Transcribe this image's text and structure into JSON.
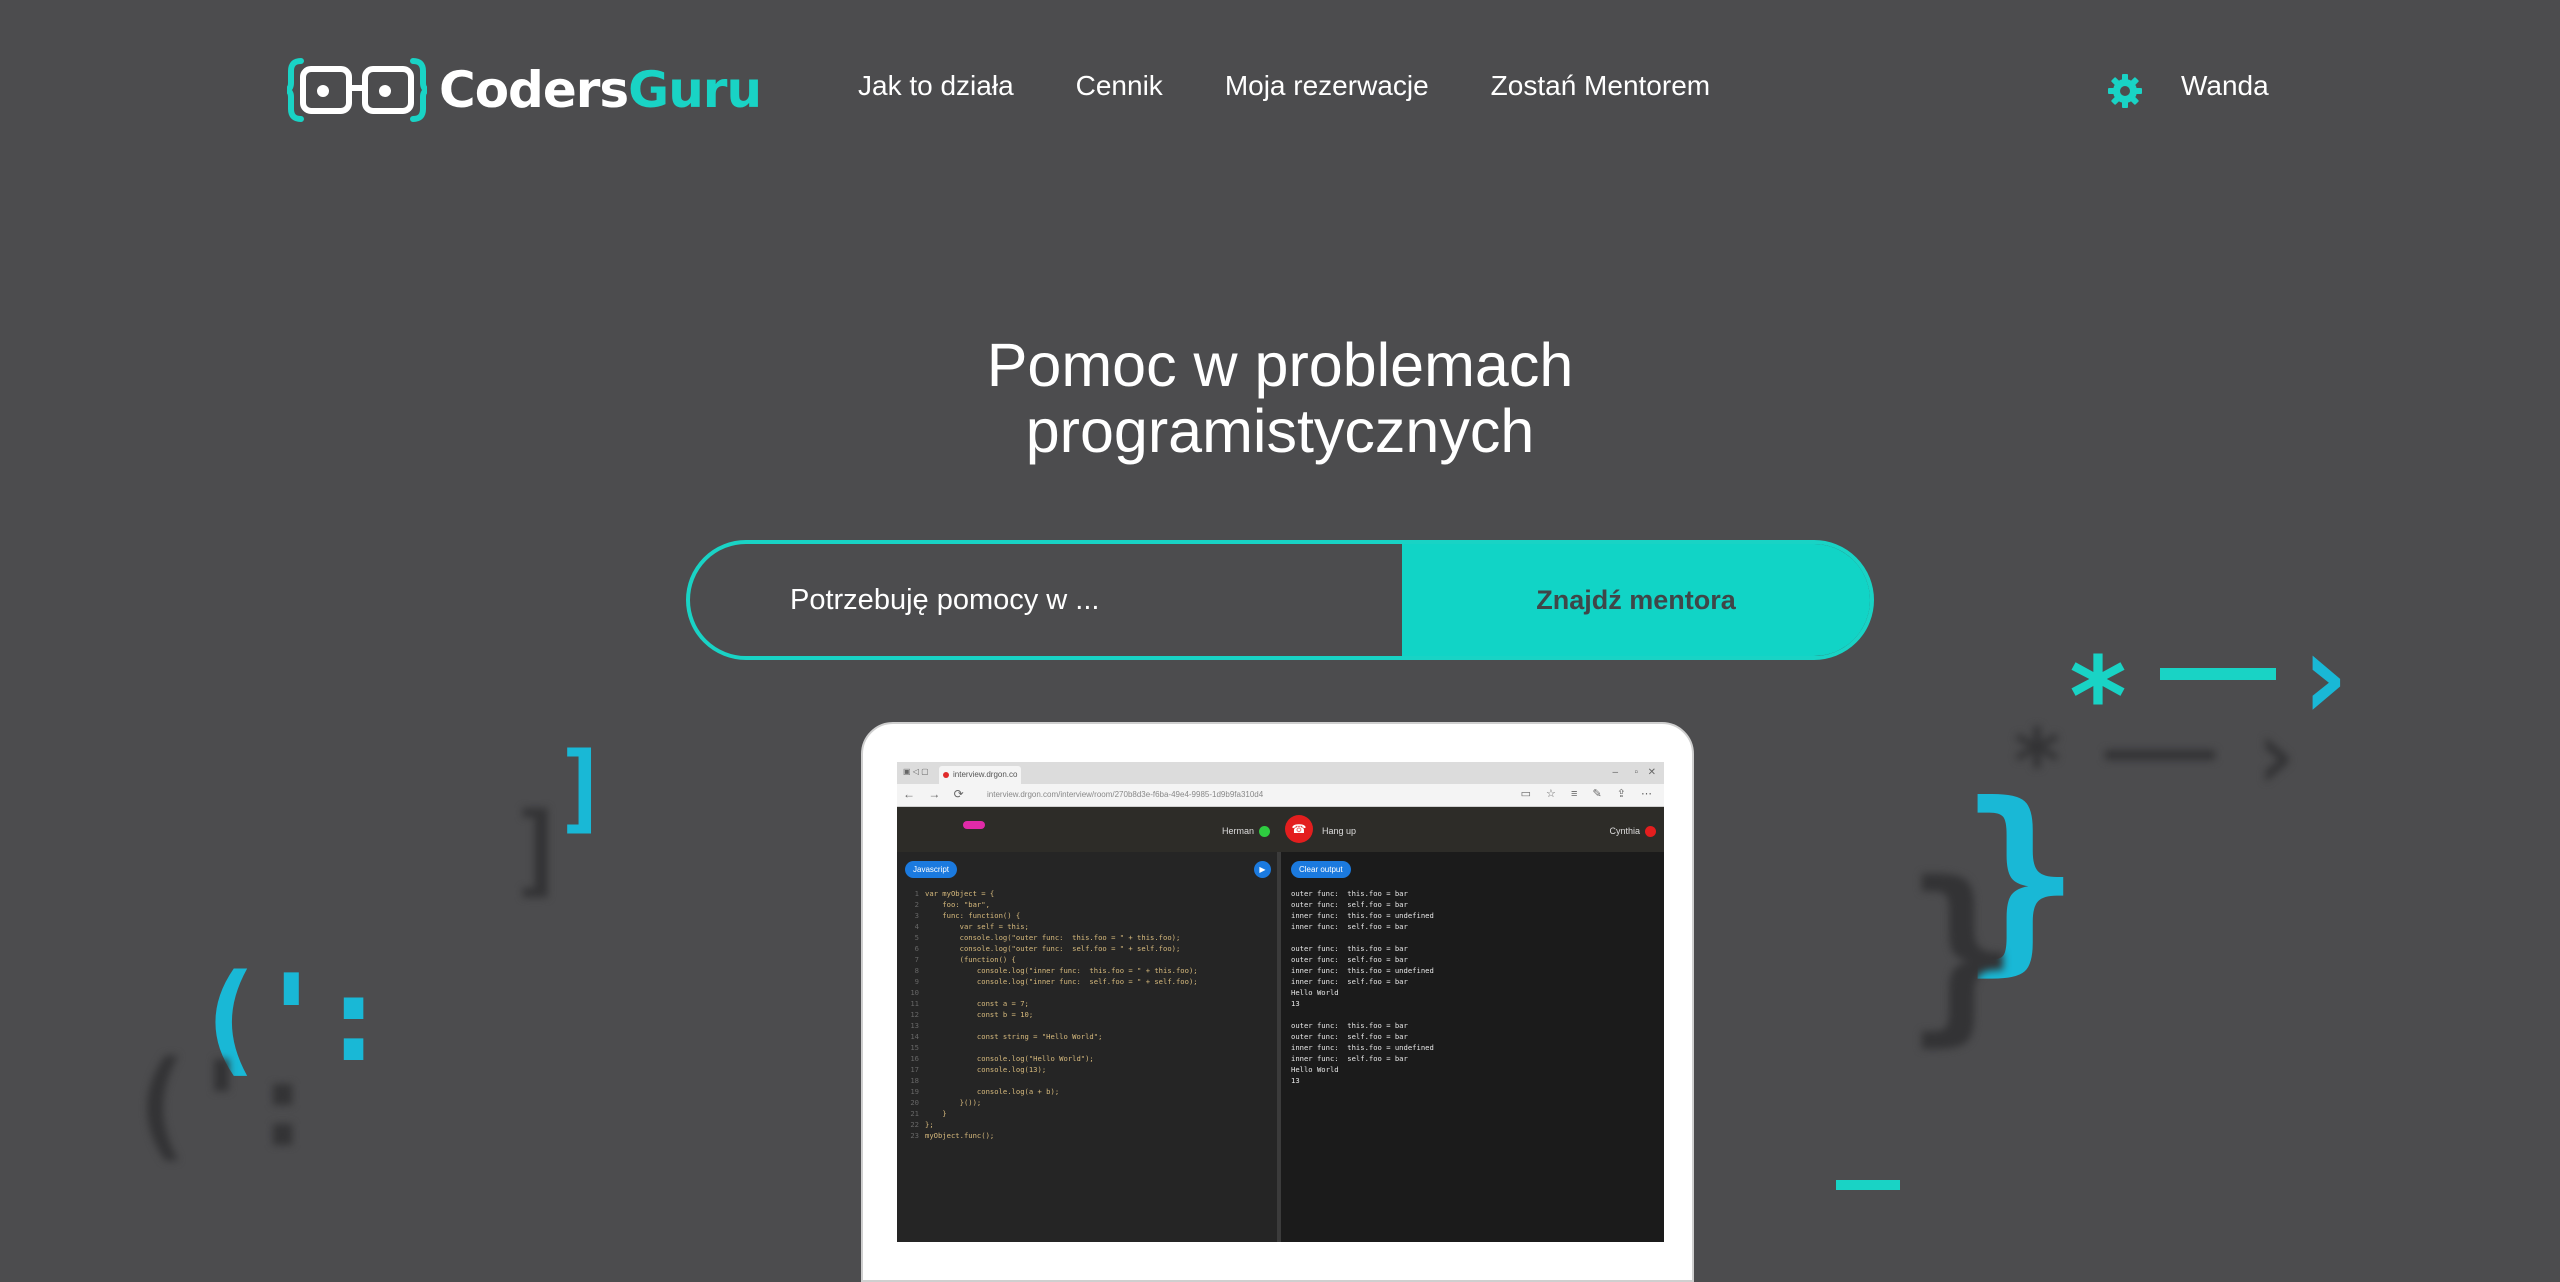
{
  "brand": {
    "name_part1": "Coders",
    "name_part2": "Guru",
    "accent": "#19d3c5",
    "background": "#4c4c4e"
  },
  "nav": {
    "items": [
      "Jak to działa",
      "Cennik",
      "Moja rezerwacje",
      "Zostań Mentorem"
    ]
  },
  "user": {
    "name": "Wanda",
    "icon": "gear-icon"
  },
  "hero": {
    "title_line1": "Pomoc w problemach",
    "title_line2": "programistycznych",
    "search_placeholder": "Potrzebuję pomocy w ...",
    "button_label": "Znajdź mentora"
  },
  "decorations": {
    "star": "*",
    "dash": "—",
    "chevron": "›",
    "bracket": "]",
    "brace": "}",
    "paren": "(':",
    "underscore": "—"
  },
  "laptop": {
    "tab_title": "interview.drgon.co",
    "url": "interview.drgon.com/interview/room/270b8d3e-f6ba-49e4-9985-1d9b9fa310d4",
    "call": {
      "left_name": "Herman",
      "hangup_label": "Hang up",
      "right_name": "Cynthia"
    },
    "language_label": "Javascript",
    "clear_label": "Clear output",
    "code_lines": [
      "var myObject = {",
      "    foo: \"bar\",",
      "    func: function() {",
      "        var self = this;",
      "        console.log(\"outer func:  this.foo = \" + this.foo);",
      "        console.log(\"outer func:  self.foo = \" + self.foo);",
      "        (function() {",
      "            console.log(\"inner func:  this.foo = \" + this.foo);",
      "            console.log(\"inner func:  self.foo = \" + self.foo);",
      "",
      "            const a = 7;",
      "            const b = 10;",
      "",
      "            const string = \"Hello World\";",
      "",
      "            console.log(\"Hello World\");",
      "            console.log(13);",
      "",
      "            console.log(a + b);",
      "        }());",
      "    }",
      "};",
      "myObject.func();"
    ],
    "output_lines": [
      "outer func:  this.foo = bar",
      "outer func:  self.foo = bar",
      "inner func:  this.foo = undefined",
      "inner func:  self.foo = bar",
      "",
      "outer func:  this.foo = bar",
      "outer func:  self.foo = bar",
      "inner func:  this.foo = undefined",
      "inner func:  self.foo = bar",
      "Hello World",
      "13",
      "",
      "outer func:  this.foo = bar",
      "outer func:  self.foo = bar",
      "inner func:  this.foo = undefined",
      "inner func:  self.foo = bar",
      "Hello World",
      "13"
    ]
  }
}
